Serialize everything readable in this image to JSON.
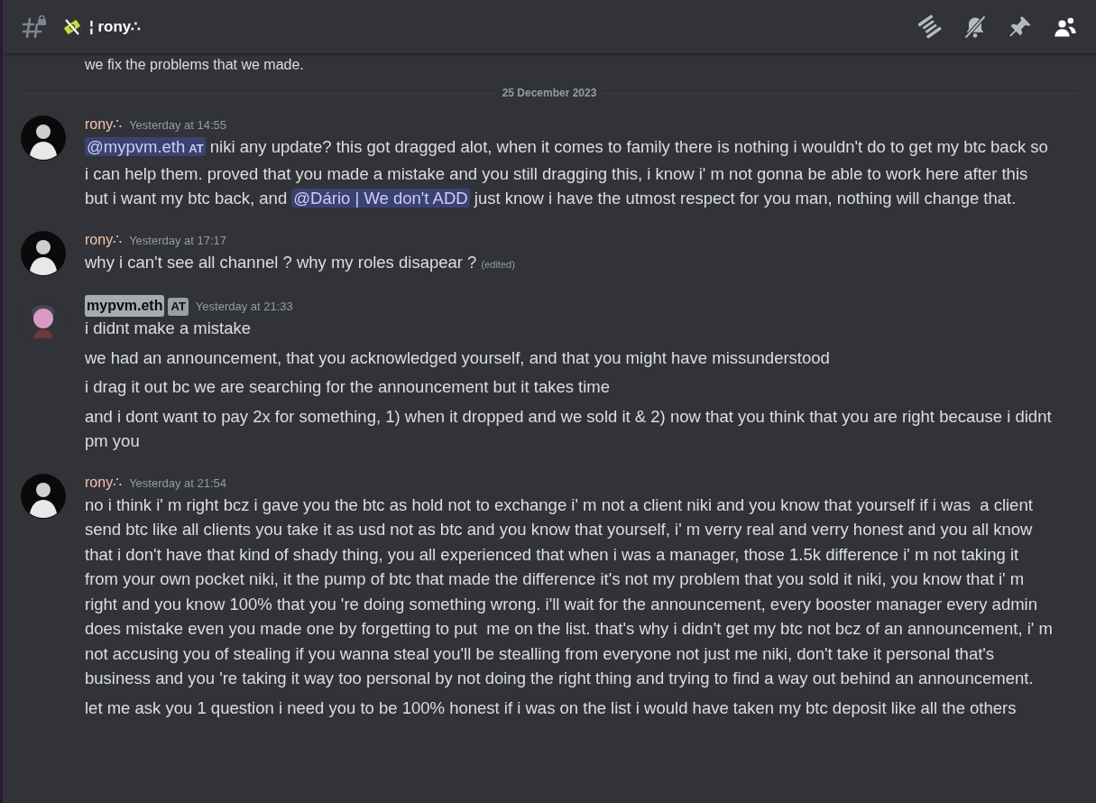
{
  "header": {
    "channel_name": "¦ rony∴"
  },
  "partial_line": "we fix the problems that we made.",
  "date_divider": "25 December 2023",
  "messages": [
    {
      "author": "rony∴",
      "kind": "dark",
      "timestamp": "Yesterday at 14:55",
      "paragraphs": [
        [
          {
            "kind": "mention",
            "text": "@mypvm.eth",
            "tag": "AT"
          },
          {
            "kind": "text",
            "text": " niki any update? this got dragged alot, when it comes to family there is nothing i wouldn't do to get my btc back so i can help them. proved that you made a mistake and you still dragging this, i know i' m not gonna be able to work here after this but i want my btc back, and "
          },
          {
            "kind": "mention",
            "text": "@Dário | We don't ADD"
          },
          {
            "kind": "text",
            "text": " just know i have the utmost respect for you man, nothing will change that."
          }
        ]
      ]
    },
    {
      "author": "rony∴",
      "kind": "dark",
      "timestamp": "Yesterday at 17:17",
      "paragraphs": [
        [
          {
            "kind": "text",
            "text": "why i can't see all channel ? why my roles disapear ? "
          },
          {
            "kind": "edited",
            "text": "(edited)"
          }
        ]
      ]
    },
    {
      "author": "mypvm.eth",
      "tag": "AT",
      "kind": "light",
      "timestamp": "Yesterday at 21:33",
      "paragraphs": [
        [
          {
            "kind": "text",
            "text": "i didnt make a mistake"
          }
        ],
        [
          {
            "kind": "text",
            "text": "we had an announcement, that you acknowledged yourself, and that you might have missunderstood"
          }
        ],
        [
          {
            "kind": "text",
            "text": "i drag it out bc we are searching for the announcement but it takes time"
          }
        ],
        [
          {
            "kind": "text",
            "text": "and i dont want to pay 2x for something, 1) when it dropped and we sold it & 2) now that you think that you are right because i didnt pm you"
          }
        ]
      ]
    },
    {
      "author": "rony∴",
      "kind": "dark",
      "timestamp": "Yesterday at 21:54",
      "paragraphs": [
        [
          {
            "kind": "text",
            "text": "no i think i' m right bcz i gave you the btc as hold not to exchange i' m not a client niki and you know that yourself if i was  a client send btc like all clients you take it as usd not as btc and you know that yourself, i' m verry real and verry honest and you all know that i don't have that kind of shady thing, you all experienced that when i was a manager, those 1.5k difference i' m not taking it from your own pocket niki, it the pump of btc that made the difference it's not my problem that you sold it niki, you know that i' m right and you know 100% that you 're doing something wrong. i'll wait for the announcement, every booster manager every admin does mistake even you made one by forgetting to put  me on the list. that's why i didn't get my btc not bcz of an announcement, i' m not accusing you of stealing if you wanna steal you'll be stealling from everyone not just me niki, don't take it personal that's business and you 're taking it way too personal by not doing the right thing and trying to find a way out behind an announcement."
          }
        ],
        [
          {
            "kind": "text",
            "text": "let me ask you 1 question i need you to be 100% honest if i was on the list i would have taken my btc deposit like all the others"
          }
        ]
      ]
    }
  ]
}
